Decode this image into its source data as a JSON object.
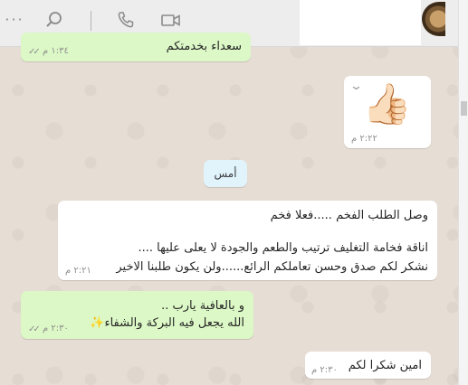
{
  "header": {
    "more_label": "···",
    "search_icon": "search-icon",
    "phone_icon": "phone-icon",
    "video_icon": "video-icon"
  },
  "messages": [
    {
      "dir": "out",
      "text": "سعداء بخدمتكم",
      "time": "١:٣٤ م",
      "ticks": "✓✓"
    },
    {
      "dir": "in",
      "emoji": "👍🏻",
      "time": "٢:٢٢ م"
    },
    {
      "dir": "in",
      "lines": [
        "وصل الطلب الفخم .....فعلا فخم",
        "",
        "اناقة فخامة التغليف ترتيب والطعم والجودة لا يعلى عليها ....",
        "نشكر لكم صدق وحسن تعاملكم الرائع......ولن يكون طلبنا الاخير"
      ],
      "time": "٢:٢١ م"
    },
    {
      "dir": "out",
      "lines": [
        "و بالعافية يارب ..",
        "الله يجعل فيه البركة والشفاء✨"
      ],
      "time": "٢:٣٠ م",
      "ticks": "✓✓"
    },
    {
      "dir": "in",
      "text": "امين شكرا لكم",
      "time": "٢:٣٠ م"
    }
  ],
  "date_chip": "أمس",
  "colors": {
    "outgoing": "#dcf8c6",
    "incoming": "#ffffff",
    "date_chip": "#e1f3fb",
    "background": "#e6ddd4"
  }
}
